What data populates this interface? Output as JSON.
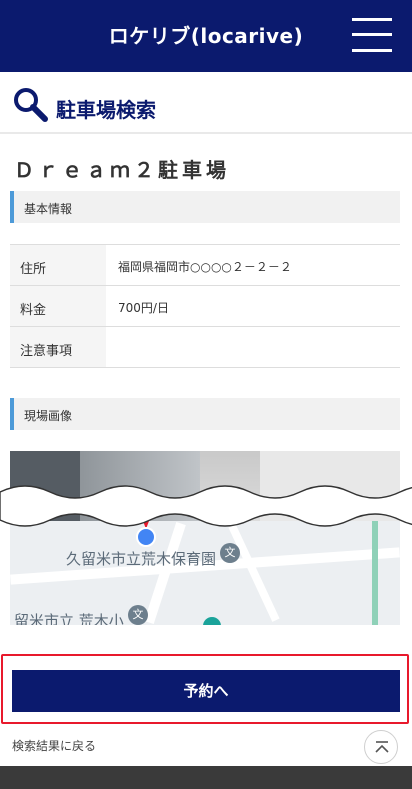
{
  "header": {
    "title": "ロケリブ(locarive)",
    "menu_icon": "hamburger-menu-icon"
  },
  "subheader": {
    "title": "駐車場検索",
    "icon": "search-icon"
  },
  "parking": {
    "name": "Ｄｒｅａｍ２駐車場",
    "basic_info_label": "基本情報",
    "table": [
      {
        "key": "住所",
        "value": "福岡県福岡市○○○○２－２－２"
      },
      {
        "key": "料金",
        "value": "700円/日"
      },
      {
        "key": "注意事項",
        "value": ""
      }
    ],
    "photo_label": "現場画像"
  },
  "map": {
    "labels": [
      "久留米市立荒木保育園",
      "留米市立 荒木小"
    ],
    "poi_glyph": "文"
  },
  "actions": {
    "reserve_label": "予約へ",
    "back_label": "検索結果に戻る",
    "top_icon": "scroll-to-top-icon"
  },
  "colors": {
    "brand": "#0b1a6e",
    "accent": "#4d9ad8",
    "highlight": "#e8192c"
  }
}
